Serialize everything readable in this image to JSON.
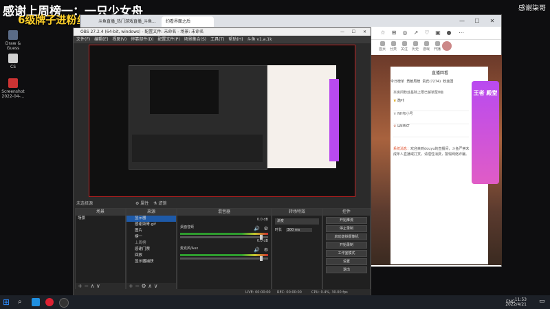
{
  "overlay": {
    "line1": "感谢上周榜一：一只少女舟",
    "line2": "6级牌子进粉丝群",
    "watermark": "感谢柒哥"
  },
  "desktop_icons": [
    {
      "label": "Draw & Guess"
    },
    {
      "label": "CS"
    },
    {
      "label": "Screenshot 2022-04-..."
    }
  ],
  "browser": {
    "tabs": [
      {
        "label": "斗鱼直播_热门游戏直播_斗鱼..."
      },
      {
        "label": "约看界面之后"
      }
    ],
    "nav": [
      "首页",
      "分类",
      "关注",
      "历史",
      "游戏",
      "开播",
      "下载"
    ],
    "chat": {
      "tabs": [
        "今日榜单",
        "贡献周榜",
        "贵宾(7274)",
        "粉丝团"
      ],
      "notice": "本房间粉丝基础上限已解锁至8级",
      "gifts": [
        {
          "name": "酷咔"
        },
        {
          "name": "NH布小号"
        },
        {
          "name": "LWMKT"
        }
      ],
      "system_label": "系统消息：",
      "system_msg": "欢迎来到douyu的直播间，斗鱼严禁未成年人直播或打赏，请理性消费，警惕网络诈骗。",
      "top_right": "直播回看",
      "promo": "王者 殿堂"
    }
  },
  "obs": {
    "title": "OBS 27.2.4 (64-bit, windows) - 配置文件: 未命名 - 场景: 未命名",
    "menu": [
      "文件(F)",
      "编辑(E)",
      "视图(V)",
      "停靠部件(D)",
      "配置文件(P)",
      "场景集合(S)",
      "工具(T)",
      "帮助(H)",
      "斗鱼 v1.a.1k"
    ],
    "source_unselected": "未选择源",
    "prop_btn": "属性",
    "filter_btn": "滤镜",
    "scenes_title": "场景",
    "scenes": [
      "场景"
    ],
    "sources_title": "来源",
    "sources": [
      "显示器",
      "感谢柒哥.gif",
      "图片",
      "榜一",
      "上周榜",
      "感谢门票",
      "回放",
      "显示器捕获"
    ],
    "mixer_title": "混音器",
    "mixer": [
      {
        "name": "桌面音频",
        "db": "0.0 dB"
      },
      {
        "name": "麦克风/Aux",
        "db": "0.0 dB"
      }
    ],
    "transition_title": "转场特效",
    "transition_type": "渐变",
    "duration_label": "时长",
    "duration": "300 ms",
    "controls_title": "控件",
    "controls": [
      "开始推流",
      "停止录制",
      "启动虚拟摄像机",
      "工作室模式",
      "设置",
      "退出"
    ],
    "controls_extra": "开始录制",
    "status": {
      "live": "LIVE: 00:00:00",
      "rec": "REC: 00:00:00",
      "cpu": "CPU: 0.4%, 30.00 fps"
    }
  },
  "taskbar": {
    "lang": "ENG",
    "time": "11:53",
    "date": "2022/4/21"
  }
}
